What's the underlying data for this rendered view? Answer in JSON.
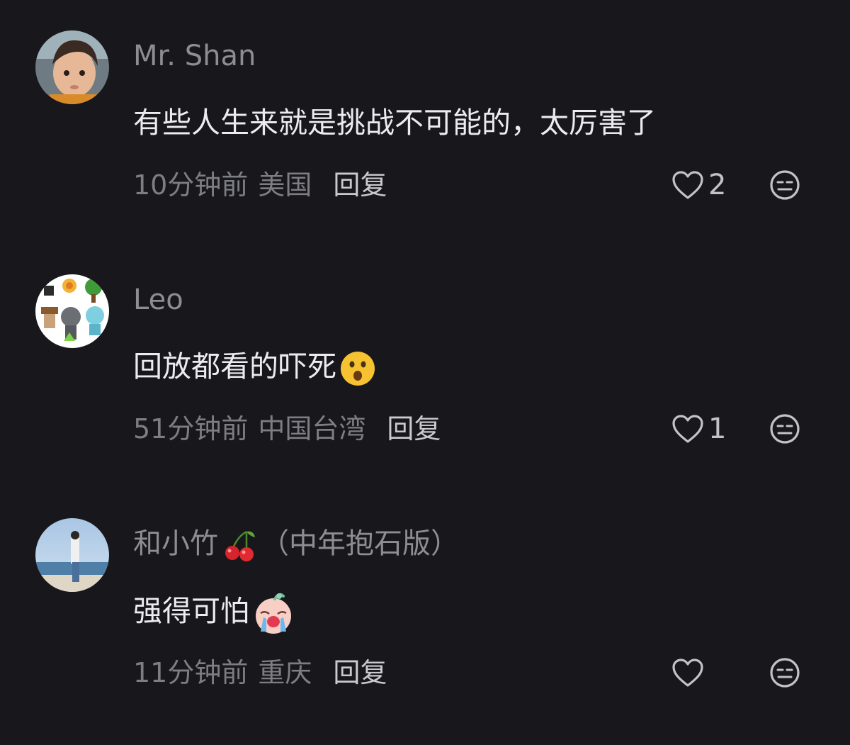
{
  "comments": [
    {
      "username": "Mr. Shan",
      "text": "有些人生来就是挑战不可能的，太厉害了",
      "time": "10分钟前",
      "location": "美国",
      "reply_label": "回复",
      "likes": "2"
    },
    {
      "username": "Leo",
      "text": "回放都看的吓死",
      "time": "51分钟前",
      "location": "中国台湾",
      "reply_label": "回复",
      "likes": "1"
    },
    {
      "username": "和小竹",
      "username_suffix": "（中年抱石版）",
      "text": "强得可怕",
      "time": "11分钟前",
      "location": "重庆",
      "reply_label": "回复",
      "likes": ""
    }
  ],
  "icons": {
    "like": "heart-outline-icon",
    "dislike": "neutral-face-icon",
    "comment_2_emoji": "astonished-face-emoji",
    "username_3_emoji": "cherries-emoji",
    "comment_3_emoji": "crying-baby-emoji"
  },
  "colors": {
    "background": "#17171c",
    "username": "#8d8d94",
    "content": "#ececef",
    "meta": "#7d7d84",
    "reply": "#c9c9ce"
  }
}
